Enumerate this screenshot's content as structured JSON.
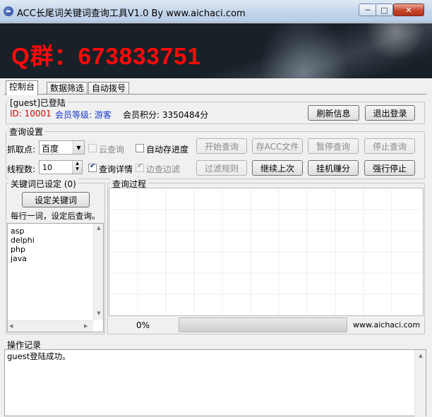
{
  "window": {
    "title": "ACC长尾词关键词查询工具V1.0  By  www.aichaci.com",
    "controls": {
      "minimize": "─",
      "maximize": "□",
      "close": "✕"
    }
  },
  "banner": {
    "text": "Q群：673833751",
    "color": "#ff0a0a"
  },
  "tabs": [
    {
      "label": "控制台",
      "active": true
    },
    {
      "label": "数据筛选",
      "active": false
    },
    {
      "label": "自动拨号",
      "active": false
    }
  ],
  "account": {
    "group_label": "[guest]已登陆",
    "id_text": "ID: 10001",
    "level_text": "会员等级: 游客",
    "points_text": "会员积分: 3350484分",
    "refresh_button": "刷新信息",
    "logout_button": "退出登录"
  },
  "query_settings": {
    "group_label": "查询设置",
    "source_label": "抓取点:",
    "source_value": "百度",
    "cloud_label": "云查询",
    "autosave_label": "自动存进度",
    "threads_label": "线程数:",
    "threads_value": "10",
    "detail_label": "查询详情",
    "edge_label": "边查边滤",
    "buttons_row1": [
      "开始查询",
      "存ACC文件",
      "暂停查询",
      "停止查询"
    ],
    "buttons_row2": [
      "过滤规则",
      "继续上次",
      "挂机赚分",
      "强行停止"
    ]
  },
  "keywords": {
    "group_label": "关键词已设定 (0)",
    "set_button": "设定关键词",
    "hint": "每行一词，设定后查询。",
    "items": [
      "asp",
      "delphi",
      "php",
      "java"
    ]
  },
  "progress": {
    "group_label": "查询过程",
    "percent_text": "0%",
    "fraction": 0,
    "site": "www.aichaci.com"
  },
  "log": {
    "label": "操作记录",
    "lines": [
      "guest登陆成功。"
    ]
  },
  "icons": {
    "app": "app-logo-icon",
    "dropdown": "chevron-down-icon",
    "spinner": "spinner-arrows-icon"
  }
}
